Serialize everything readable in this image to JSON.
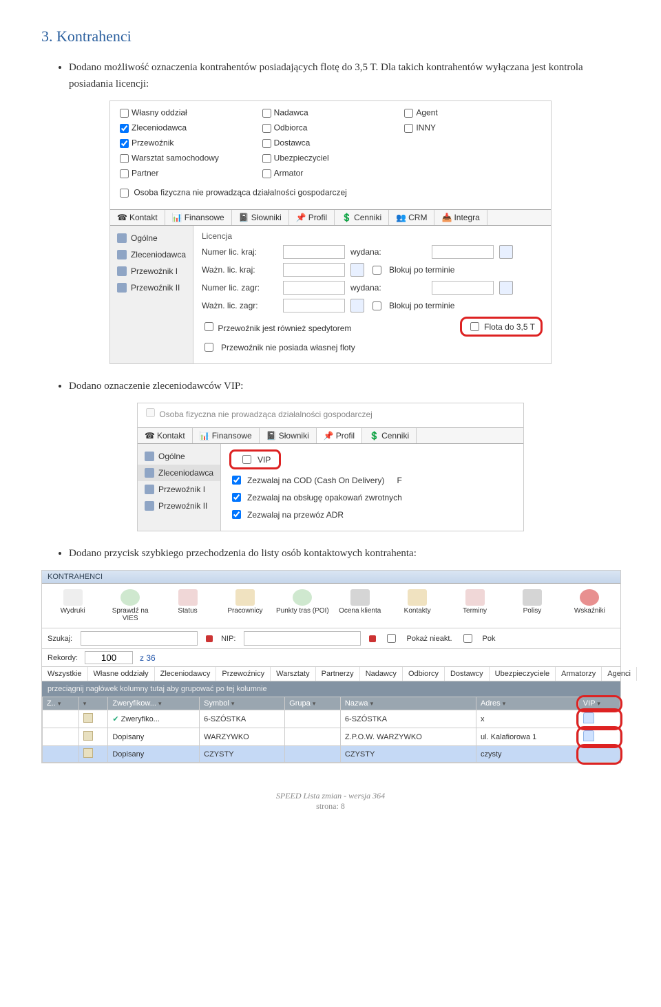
{
  "section": {
    "title": "3. Kontrahenci",
    "bullet1": "Dodano możliwość oznaczenia kontrahentów posiadających flotę do 3,5 T. Dla takich kontrahentów wyłączana jest kontrola posiadania licencji:",
    "bullet2": "Dodano oznaczenie zleceniodawców VIP:",
    "bullet3": "Dodano przycisk szybkiego przechodzenia do listy osób kontaktowych kontrahenta:"
  },
  "ss1": {
    "checkboxes": {
      "col1": [
        {
          "label": "Własny oddział",
          "checked": false
        },
        {
          "label": "Zleceniodawca",
          "checked": true
        },
        {
          "label": "Przewoźnik",
          "checked": true
        },
        {
          "label": "Warsztat samochodowy",
          "checked": false
        },
        {
          "label": "Partner",
          "checked": false
        }
      ],
      "col2": [
        {
          "label": "Nadawca",
          "checked": false
        },
        {
          "label": "Odbiorca",
          "checked": false
        },
        {
          "label": "Dostawca",
          "checked": false
        },
        {
          "label": "Ubezpieczyciel",
          "checked": false
        },
        {
          "label": "Armator",
          "checked": false
        }
      ],
      "col3": [
        {
          "label": "Agent",
          "checked": false
        },
        {
          "label": "INNY",
          "checked": false
        }
      ]
    },
    "osoba": "Osoba fizyczna nie prowadząca działalności gospodarczej",
    "tabs": [
      "Kontakt",
      "Finansowe",
      "Słowniki",
      "Profil",
      "Cenniki",
      "CRM",
      "Integra"
    ],
    "sideTabs": [
      "Ogólne",
      "Zleceniodawca",
      "Przewoźnik I",
      "Przewoźnik II"
    ],
    "profil": {
      "legend": "Licencja",
      "numer_kraj_label": "Numer lic. kraj:",
      "wydana_label": "wydana:",
      "wazn_kraj_label": "Ważn. lic. kraj:",
      "blokuj_label": "Blokuj po terminie",
      "numer_zagr_label": "Numer lic. zagr:",
      "wazn_zagr_label": "Ważn. lic. zagr:",
      "spedytor_label": "Przewoźnik jest również spedytorem",
      "flota_label": "Flota do 3,5 T",
      "brak_floty_label": "Przewoźnik nie posiada własnej floty"
    }
  },
  "ss2": {
    "toptext": "Osoba fizyczna nie prowadząca działalności gospodarczej",
    "tabs": [
      "Kontakt",
      "Finansowe",
      "Słowniki",
      "Profil",
      "Cenniki"
    ],
    "sideTabs": [
      "Ogólne",
      "Zleceniodawca",
      "Przewoźnik I",
      "Przewoźnik II"
    ],
    "vip_label": "VIP",
    "opt1": "Zezwalaj na COD (Cash On Delivery)",
    "opt2": "Zezwalaj na obsługę opakowań zwrotnych",
    "opt3": "Zezwalaj na przewóz ADR",
    "side_f": "F"
  },
  "ss3": {
    "title": "KONTRAHENCI",
    "toolbar": [
      "Wydruki",
      "Sprawdź na VIES",
      "Status",
      "Pracownicy",
      "Punkty tras (POI)",
      "Ocena klienta",
      "Kontakty",
      "Terminy",
      "Polisy",
      "Wskaźniki"
    ],
    "szukaj_label": "Szukaj:",
    "nip_label": "NIP:",
    "pokaz_label": "Pokaż nieakt.",
    "pok_label": "Pok",
    "rekordy_label": "Rekordy:",
    "rekordy_value": "100",
    "z_label": "z 36",
    "filter_tabs": [
      "Wszystkie",
      "Własne oddziały",
      "Zleceniodawcy",
      "Przewoźnicy",
      "Warsztaty",
      "Partnerzy",
      "Nadawcy",
      "Odbiorcy",
      "Dostawcy",
      "Ubezpieczyciele",
      "Armatorzy",
      "Agenci"
    ],
    "group_text": "przeciągnij nagłówek kolumny tutaj aby grupować po tej kolumnie",
    "headers": [
      "Z..",
      "",
      "Zweryfikow...",
      "Symbol",
      "Grupa",
      "Nazwa",
      "Adres",
      "VIP"
    ],
    "rows": [
      {
        "status": "Zweryfiko...",
        "symbol": "6-SZÓSTKA",
        "grupa": "",
        "nazwa": "6-SZÓSTKA",
        "adres": "x",
        "vip": true,
        "status_class": "zwer"
      },
      {
        "status": "Dopisany",
        "symbol": "WARZYWKO",
        "grupa": "",
        "nazwa": "Z.P.O.W. WARZYWKO",
        "adres": "ul. Kalafiorowa 1",
        "vip": true,
        "status_class": "dop"
      },
      {
        "status": "Dopisany",
        "symbol": "CZYSTY",
        "grupa": "",
        "nazwa": "CZYSTY",
        "adres": "czysty",
        "vip": false,
        "status_class": "dop",
        "selected": true
      }
    ]
  },
  "footer": {
    "line1": "SPEED Lista zmian - wersja 364",
    "line2": "strona: 8"
  }
}
